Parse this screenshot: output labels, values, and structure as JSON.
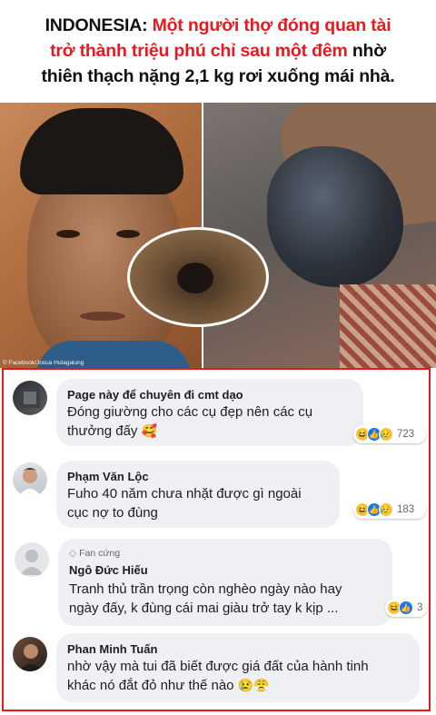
{
  "headline": {
    "line1_black": "INDONESIA: ",
    "line1_red": "Một người thợ đóng quan tài",
    "line2_red": "trở thành triệu phú chỉ sau một đêm",
    "line2_black": " nhờ",
    "line3_black": "thiên thạch nặng 2,1 kg rơi xuống mái nhà."
  },
  "photos": {
    "credit": "© Facebook/Josua Hutagalung"
  },
  "comments": [
    {
      "name": "Page này để chuyên đi cmt dạo",
      "text_line1": "Đóng giường cho các cụ đẹp nên các cụ",
      "text_line2": "thưởng đấy",
      "emoji": "🥰",
      "reaction_count": "723",
      "reactions": [
        "haha",
        "like",
        "sad"
      ]
    },
    {
      "name": "Phạm Văn Lộc",
      "text_line1": "Fuho 40 năm chưa nhặt được gì ngoài",
      "text_line2": "cục nợ to đùng",
      "reaction_count": "183",
      "reactions": [
        "haha",
        "like",
        "sad"
      ]
    },
    {
      "badge": "Fan cứng",
      "name": "Ngô Đức Hiếu",
      "text_line1": "Tranh thủ trần trọng còn nghèo ngày nào hay",
      "text_line2": "ngày đấy, k đùng cái mai giàu trở tay k kịp ...",
      "reaction_count": "3",
      "reactions": [
        "haha",
        "like"
      ]
    },
    {
      "name": "Phan Minh Tuấn",
      "text_line1": "nhờ vậy mà tui đã biết được giá đất của hành tinh",
      "text_line2": "khác nó đắt đỏ như thế nào",
      "emoji": "😢😤"
    }
  ],
  "colors": {
    "headline_red": "#e31b23",
    "frame_red": "#e21a1a",
    "bubble_bg": "#eef0f3",
    "like_blue": "#1877f2"
  }
}
